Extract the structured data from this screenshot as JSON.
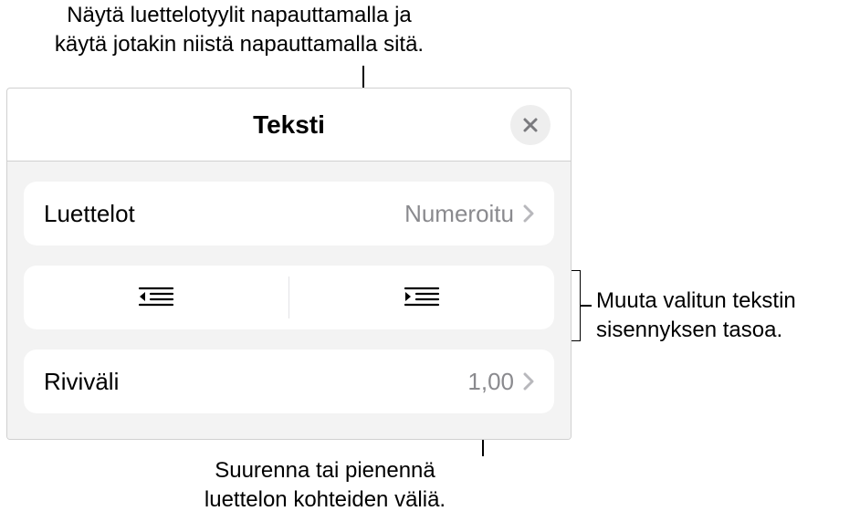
{
  "annotations": {
    "top": "Näytä luettelotyylit napauttamalla ja\nkäytä jotakin niistä napauttamalla sitä.",
    "right": "Muuta valitun tekstin\nsisennyksen tasoa.",
    "bottom": "Suurenna tai pienennä\nluettelon kohteiden väliä."
  },
  "panel": {
    "title": "Teksti",
    "lists": {
      "label": "Luettelot",
      "value": "Numeroitu"
    },
    "linespacing": {
      "label": "Riviväli",
      "value": "1,00"
    }
  }
}
